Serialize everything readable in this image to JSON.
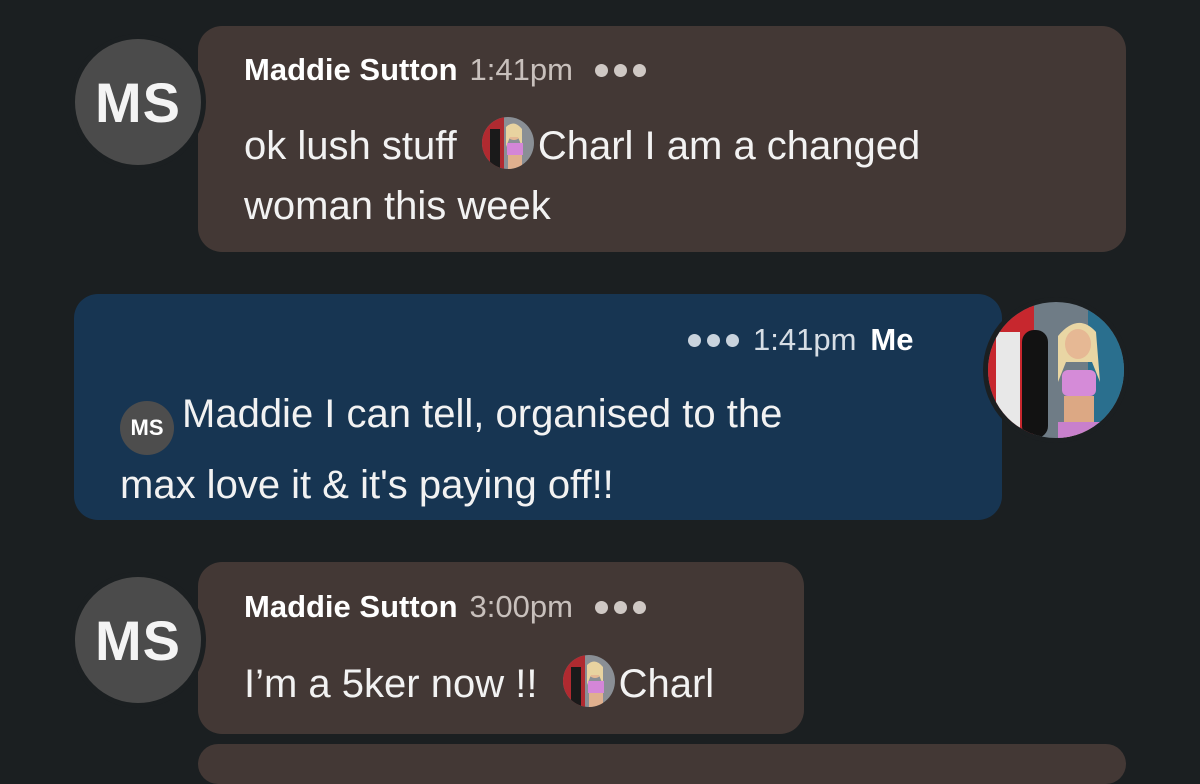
{
  "messages": [
    {
      "sender": "Maddie Sutton",
      "avatar_initials": "MS",
      "time": "1:41pm",
      "text_before": "ok lush stuff ",
      "mention_name": "Charl",
      "text_line1_after": " I am a changed",
      "text_line2": "woman this week"
    },
    {
      "sender_label": "Me",
      "time": "1:41pm",
      "mention_initials": "MS",
      "text_line1": "Maddie I can tell, organised to the",
      "text_line2": "max love it & it's paying off!!"
    },
    {
      "sender": "Maddie Sutton",
      "avatar_initials": "MS",
      "time": "3:00pm",
      "text_before": "I’m a 5ker now !! ",
      "mention_name": "Charl"
    }
  ],
  "colors": {
    "background": "#1b1f21",
    "incoming_bubble": "#433835",
    "outgoing_bubble": "#173552"
  },
  "icons": [
    "more-dots-icon",
    "profile-photo-icon"
  ]
}
